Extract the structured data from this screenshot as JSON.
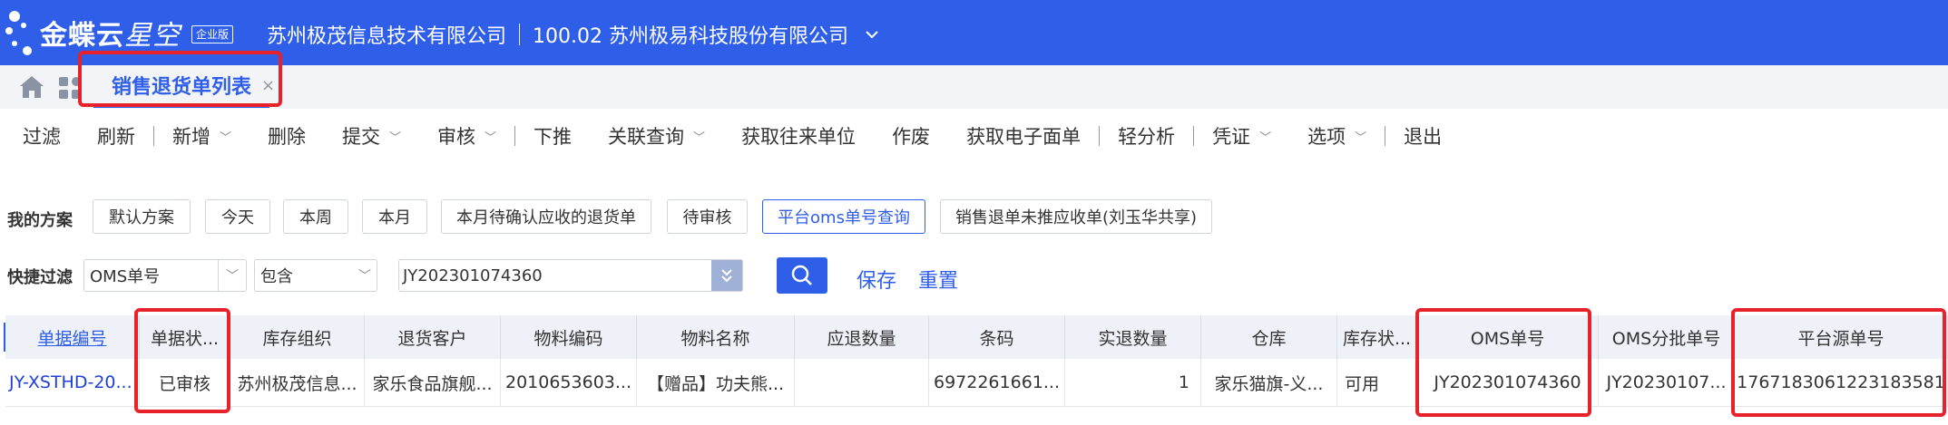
{
  "header": {
    "logo_brand": "金蝶云",
    "logo_product": "星空",
    "edition": "企业版",
    "org": "苏州极茂信息技术有限公司",
    "account": "100.02 苏州极易科技股份有限公司"
  },
  "tab": {
    "title": "销售退货单列表",
    "close": "×"
  },
  "toolbar": {
    "items": [
      "过滤",
      "刷新",
      "新增",
      "删除",
      "提交",
      "审核",
      "下推",
      "关联查询",
      "获取往来单位",
      "作废",
      "获取电子面单",
      "轻分析",
      "凭证",
      "选项",
      "退出"
    ]
  },
  "schemes": {
    "label": "我的方案",
    "items": [
      "默认方案",
      "今天",
      "本周",
      "本月",
      "本月待确认应收的退货单",
      "待审核",
      "平台oms单号查询",
      "销售退单未推应收单(刘玉华共享)"
    ],
    "active": "平台oms单号查询"
  },
  "quick_filter": {
    "label": "快捷过滤",
    "field": "OMS单号",
    "operator": "包含",
    "value": "JY202301074360",
    "save": "保存",
    "reset": "重置"
  },
  "table": {
    "columns": [
      "单据编号",
      "单据状...",
      "库存组织",
      "退货客户",
      "物料编码",
      "物料名称",
      "应退数量",
      "条码",
      "实退数量",
      "仓库",
      "库存状...",
      "OMS单号",
      "OMS分批单号",
      "平台源单号"
    ],
    "row": [
      "JY-XSTHD-20...",
      "已审核",
      "苏州极茂信息...",
      "家乐食品旗舰...",
      "2010653603...",
      "【赠品】功夫熊...",
      "",
      "6972261661...",
      "1",
      "家乐猫旗-义...",
      "可用",
      "JY202301074360",
      "JY20230107...",
      "1767183061223183581"
    ]
  },
  "colors": {
    "brand_blue": "#2f5fe9",
    "highlight_red": "#e8222b"
  }
}
